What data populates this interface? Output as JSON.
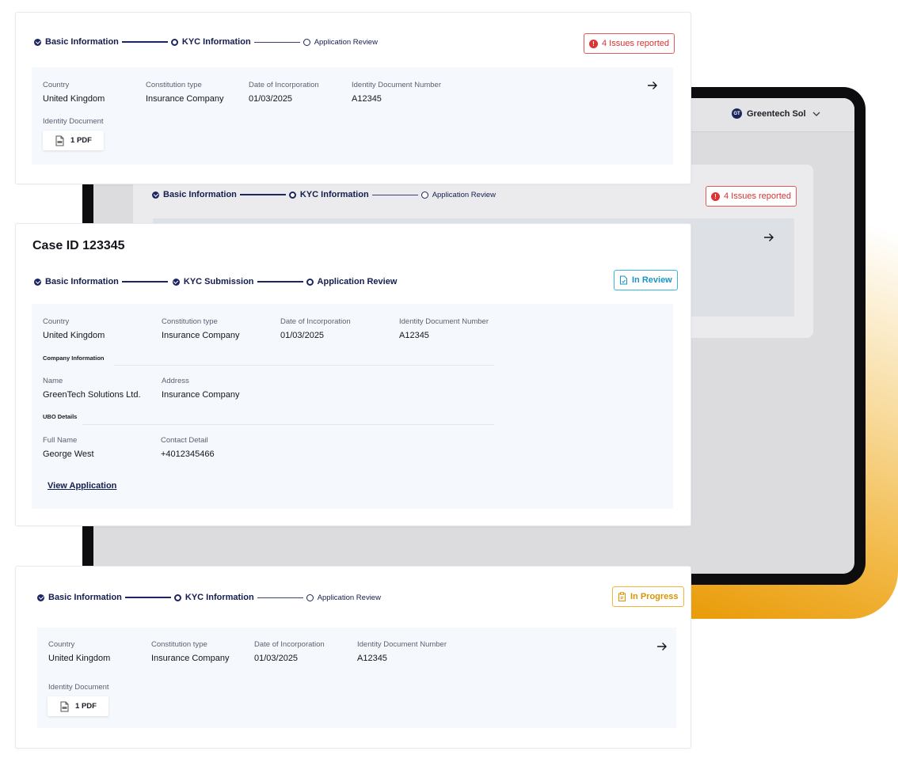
{
  "device": {
    "user": {
      "initials": "GT",
      "name": "Greentech Sol",
      "menu_icon": "chevron-down-icon"
    },
    "back_card": {
      "steps": [
        {
          "label": "Basic Information",
          "state": "done"
        },
        {
          "label": "KYC Information",
          "state": "active"
        },
        {
          "label": "Application Review",
          "state": "todo"
        }
      ],
      "issues_badge": "4 Issues reported"
    }
  },
  "card_top": {
    "steps": [
      {
        "label": "Basic Information",
        "state": "done"
      },
      {
        "label": "KYC Information",
        "state": "active"
      },
      {
        "label": "Application Review",
        "state": "todo"
      }
    ],
    "issues_badge": "4 Issues reported",
    "fields": [
      {
        "label": "Country",
        "value": "United Kingdom"
      },
      {
        "label": "Constitution type",
        "value": "Insurance Company"
      },
      {
        "label": "Date of Incorporation",
        "value": "01/03/2025"
      },
      {
        "label": "Identity Document Number",
        "value": "A12345"
      }
    ],
    "document_label": "Identity Document",
    "document_chip": "1 PDF"
  },
  "card_middle": {
    "title": "Case ID 123345",
    "steps": [
      {
        "label": "Basic Information",
        "state": "done"
      },
      {
        "label": "KYC Submission",
        "state": "done"
      },
      {
        "label": "Application Review",
        "state": "active"
      }
    ],
    "status_badge": "In Review",
    "fields": [
      {
        "label": "Country",
        "value": "United Kingdom"
      },
      {
        "label": "Constitution type",
        "value": "Insurance Company"
      },
      {
        "label": "Date of Incorporation",
        "value": "01/03/2025"
      },
      {
        "label": "Identity Document Number",
        "value": "A12345"
      }
    ],
    "company_section": {
      "title": "Company Information",
      "fields": [
        {
          "label": "Name",
          "value": "GreenTech Solutions Ltd."
        },
        {
          "label": "Address",
          "value": "Insurance Company"
        }
      ]
    },
    "ubo_section": {
      "title": "UBO Details",
      "fields": [
        {
          "label": "Full Name",
          "value": "George West"
        },
        {
          "label": "Contact Detail",
          "value": "+4012345466"
        }
      ]
    },
    "view_link": "View Application"
  },
  "card_bottom": {
    "steps": [
      {
        "label": "Basic Information",
        "state": "done"
      },
      {
        "label": "KYC Information",
        "state": "active"
      },
      {
        "label": "Application Review",
        "state": "todo"
      }
    ],
    "status_badge": "In Progress",
    "fields": [
      {
        "label": "Country",
        "value": "United Kingdom"
      },
      {
        "label": "Constitution type",
        "value": "Insurance Company"
      },
      {
        "label": "Date of Incorporation",
        "value": "01/03/2025"
      },
      {
        "label": "Identity Document Number",
        "value": "A12345"
      }
    ],
    "document_label": "Identity Document",
    "document_chip": "1 PDF"
  }
}
